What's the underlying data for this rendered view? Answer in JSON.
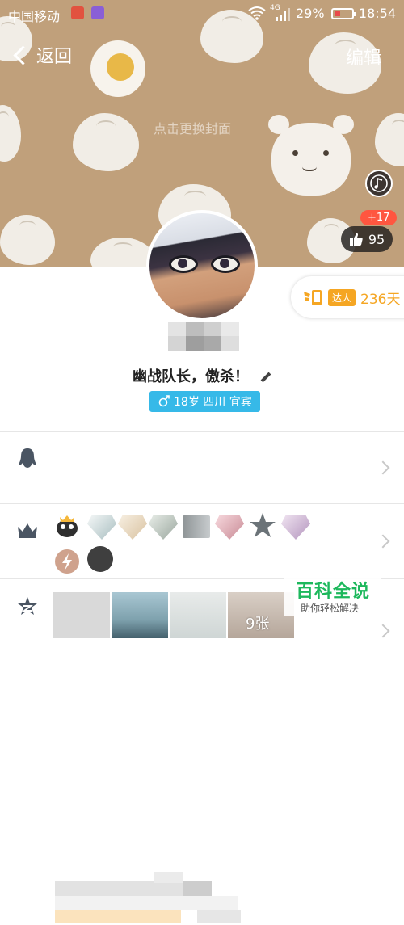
{
  "status_bar": {
    "carrier": "中国移动",
    "network": "4G",
    "battery": "29%",
    "time": "18:54"
  },
  "nav": {
    "back_label": "返回",
    "edit_label": "编辑"
  },
  "cover": {
    "hint": "点击更换封面"
  },
  "likes": {
    "increment": "+17",
    "count": "95"
  },
  "badge": {
    "tag": "达人",
    "days": "236天"
  },
  "profile": {
    "signature": "幽战队长，傲杀！",
    "info": "18岁 四川 宜宾"
  },
  "photos": {
    "count": "9张"
  },
  "watermark": {
    "title": "百科全说",
    "subtitle": "助你轻松解决"
  },
  "colors": {
    "cover_bg": "#c0a07b",
    "accent_blue": "#36b9e8",
    "accent_orange": "#f5a623",
    "like_red": "#ff5640"
  }
}
